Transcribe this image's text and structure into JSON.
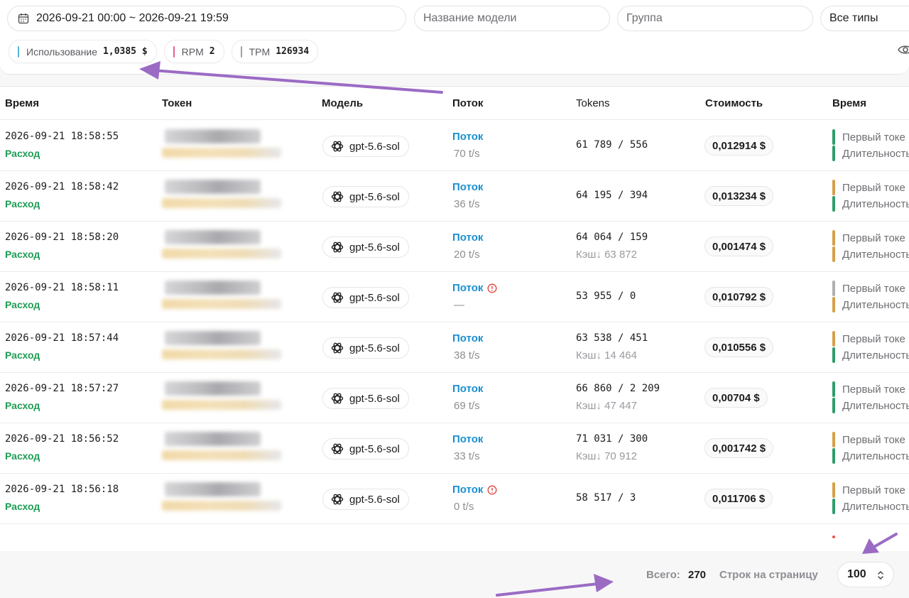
{
  "filters": {
    "date_range": "2026-09-21 00:00 ~ 2026-09-21 19:59",
    "model_placeholder": "Название модели",
    "group_placeholder": "Группа",
    "type_selected": "Все типы"
  },
  "stats": [
    {
      "label": "Использование",
      "value": "1,0385 $",
      "color": "#5ab4d6"
    },
    {
      "label": "RPM",
      "value": "2",
      "color": "#e8608a"
    },
    {
      "label": "TPM",
      "value": "126934",
      "color": "#a0a0a5"
    }
  ],
  "columns": [
    "Время",
    "Токен",
    "Модель",
    "Поток",
    "Tokens",
    "Стоимость",
    "Время"
  ],
  "rows": [
    {
      "time": "2026-09-21 18:58:55",
      "type": "Расход",
      "model": "gpt-5.6-sol",
      "stream": "Поток",
      "warn": false,
      "speed": "70 t/s",
      "tokens": "61 789 / 556",
      "cache": "",
      "cost": "0,012914 $",
      "bar_top": "#2e9e6b",
      "bar_bottom": "#2e9e6b",
      "first_token": "Первый токе",
      "duration": "Длительность"
    },
    {
      "time": "2026-09-21 18:58:42",
      "type": "Расход",
      "model": "gpt-5.6-sol",
      "stream": "Поток",
      "warn": false,
      "speed": "36 t/s",
      "tokens": "64 195 / 394",
      "cache": "",
      "cost": "0,013234 $",
      "bar_top": "#d6a04a",
      "bar_bottom": "#2e9e6b",
      "first_token": "Первый токе",
      "duration": "Длительность"
    },
    {
      "time": "2026-09-21 18:58:20",
      "type": "Расход",
      "model": "gpt-5.6-sol",
      "stream": "Поток",
      "warn": false,
      "speed": "20 t/s",
      "tokens": "64 064 / 159",
      "cache": "Кэш↓ 63 872",
      "cost": "0,001474 $",
      "bar_top": "#d6a04a",
      "bar_bottom": "#d6a04a",
      "first_token": "Первый токе",
      "duration": "Длительность"
    },
    {
      "time": "2026-09-21 18:58:11",
      "type": "Расход",
      "model": "gpt-5.6-sol",
      "stream": "Поток",
      "warn": true,
      "speed": "—",
      "tokens": "53 955 / 0",
      "cache": "",
      "cost": "0,010792 $",
      "bar_top": "#b0b0b4",
      "bar_bottom": "#d6a04a",
      "first_token": "Первый токе",
      "duration": "Длительность"
    },
    {
      "time": "2026-09-21 18:57:44",
      "type": "Расход",
      "model": "gpt-5.6-sol",
      "stream": "Поток",
      "warn": false,
      "speed": "38 t/s",
      "tokens": "63 538 / 451",
      "cache": "Кэш↓ 14 464",
      "cost": "0,010556 $",
      "bar_top": "#d6a04a",
      "bar_bottom": "#2e9e6b",
      "first_token": "Первый токе",
      "duration": "Длительность"
    },
    {
      "time": "2026-09-21 18:57:27",
      "type": "Расход",
      "model": "gpt-5.6-sol",
      "stream": "Поток",
      "warn": false,
      "speed": "69 t/s",
      "tokens": "66 860 / 2 209",
      "cache": "Кэш↓ 47 447",
      "cost": "0,00704 $",
      "bar_top": "#2e9e6b",
      "bar_bottom": "#2e9e6b",
      "first_token": "Первый токе",
      "duration": "Длительность"
    },
    {
      "time": "2026-09-21 18:56:52",
      "type": "Расход",
      "model": "gpt-5.6-sol",
      "stream": "Поток",
      "warn": false,
      "speed": "33 t/s",
      "tokens": "71 031 / 300",
      "cache": "Кэш↓ 70 912",
      "cost": "0,001742 $",
      "bar_top": "#d6a04a",
      "bar_bottom": "#2e9e6b",
      "first_token": "Первый токе",
      "duration": "Длительность"
    },
    {
      "time": "2026-09-21 18:56:18",
      "type": "Расход",
      "model": "gpt-5.6-sol",
      "stream": "Поток",
      "warn": true,
      "speed": "0 t/s",
      "tokens": "58 517 / 3",
      "cache": "",
      "cost": "0,011706 $",
      "bar_top": "#d6a04a",
      "bar_bottom": "#2e9e6b",
      "first_token": "Первый токе",
      "duration": "Длительность"
    }
  ],
  "footer": {
    "total_label": "Всего:",
    "total_value": "270",
    "rows_per_page_label": "Строк на страницу",
    "rows_per_page_value": "100"
  },
  "annotation_color": "#9b6bc4"
}
